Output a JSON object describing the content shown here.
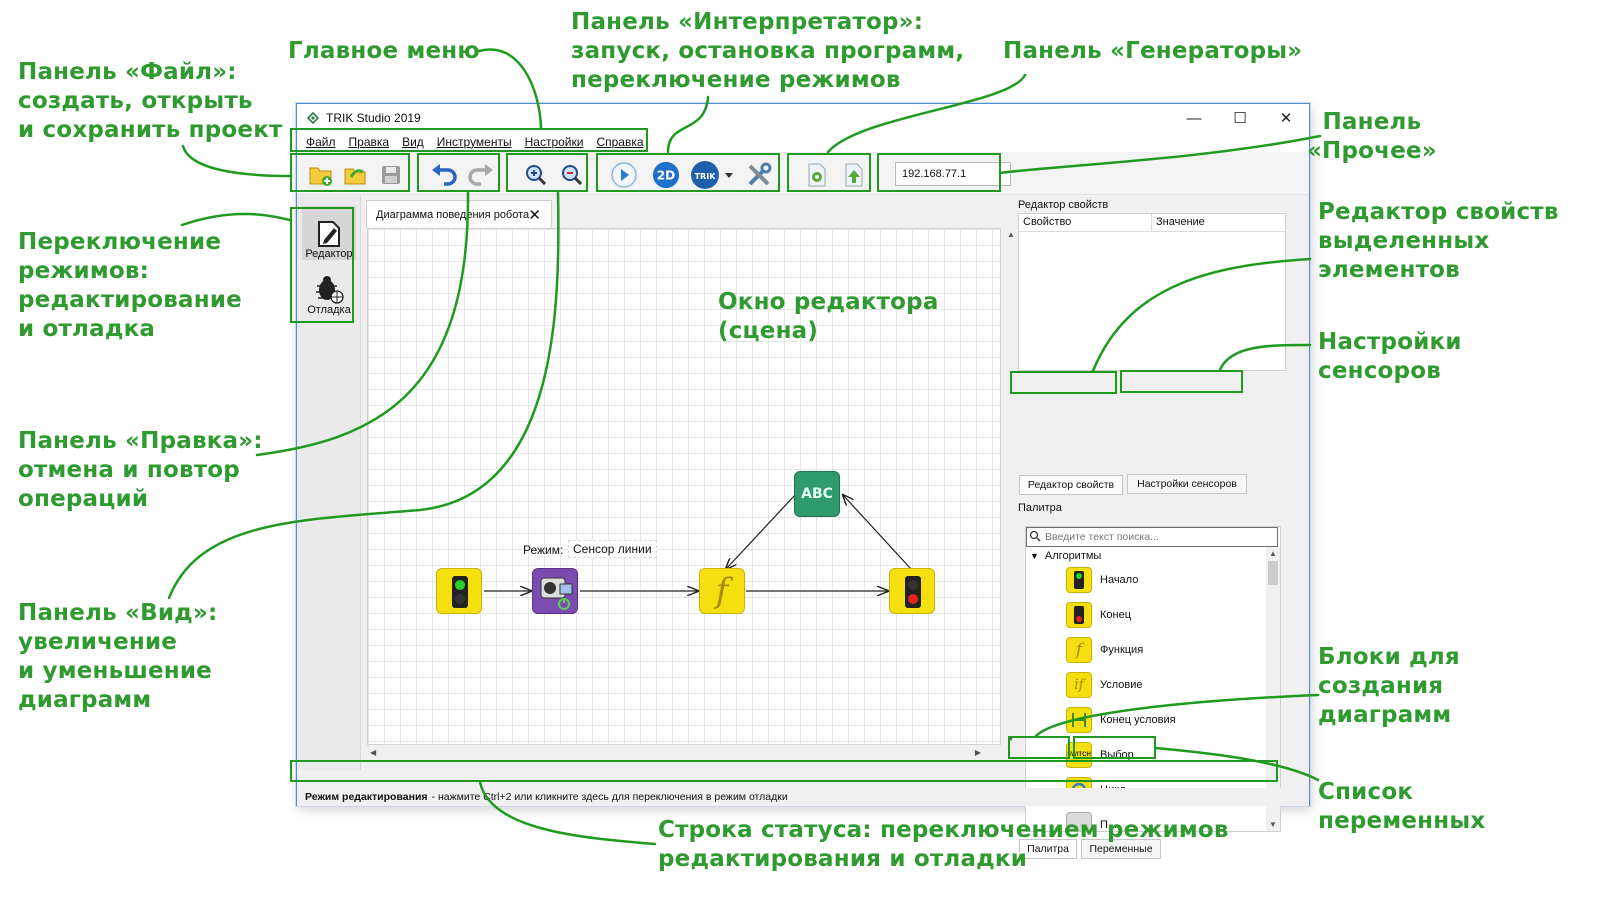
{
  "window": {
    "title": "TRIK Studio 2019",
    "controls": {
      "minimize": "—",
      "maximize": "☐",
      "close": "✕"
    }
  },
  "menu": [
    "Файл",
    "Правка",
    "Вид",
    "Инструменты",
    "Настройки",
    "Справка"
  ],
  "toolbar": {
    "ip_address": "192.168.77.1",
    "icons": [
      "new-project-icon",
      "open-project-icon",
      "save-icon",
      "undo-icon",
      "redo-icon",
      "zoom-in-icon",
      "zoom-out-icon",
      "run-icon",
      "2d-model-icon",
      "trik-robot-icon",
      "settings-tools-icon",
      "generate-code-icon",
      "upload-icon"
    ],
    "mode_2d_label": "2D",
    "trik_label": "TRIK"
  },
  "modes": {
    "editor": "Редактор",
    "debug": "Отладка"
  },
  "scene": {
    "tab_title": "Диаграмма поведения робота",
    "mode_label": "Режим:",
    "mode_value": "Сенсор линии",
    "print_block_text": "ABC",
    "function_block_text": "f"
  },
  "properties": {
    "title": "Редактор свойств",
    "col_property": "Свойство",
    "col_value": "Значение",
    "tabs": [
      "Редактор свойств",
      "Настройки сенсоров"
    ]
  },
  "palette": {
    "title": "Палитра",
    "search_placeholder": "Введите текст поиска...",
    "group": "Алгоритмы",
    "items": [
      "Начало",
      "Конец",
      "Функция",
      "Условие",
      "Конец условия",
      "Выбор",
      "Цикл",
      "П..."
    ],
    "switch_icon_text": "SWITCH",
    "tabs": [
      "Палитра",
      "Переменные"
    ]
  },
  "status": {
    "bold": "Режим редактирования",
    "text": "- нажмите Ctrl+2 или кликните здесь для переключения в режим отладки"
  },
  "annotations": {
    "file_panel": "Панель «Файл»:\nсоздать, открыть\nи сохранить проект",
    "main_menu": "Главное меню",
    "interpreter": "Панель «Интерпретатор»:\nзапуск, остановка программ,\nпереключение режимов",
    "generators": "Панель «Генераторы»",
    "other": "Панель\n«Прочее»",
    "modes": "Переключение\nрежимов:\nредактирование\nи отладка",
    "edit_panel": "Панель «Правка»:\nотмена и повтор\nопераций",
    "view_panel": "Панель «Вид»:\nувеличение\nи уменьшение\nдиаграмм",
    "editor_window": "Окно редактора\n(сцена)",
    "properties_editor": "Редактор свойств\nвыделенных\nэлементов",
    "sensor_settings": "Настройки\nсенсоров",
    "blocks": "Блоки для\nсоздания\nдиаграмм",
    "variables": "Список\nпеременных",
    "status_bar": "Строка статуса: переключением режимов\nредактирования и отладки"
  },
  "colors": {
    "annotation_green": "#2f9a2f",
    "highlight_green": "#1f9a1f",
    "block_yellow": "#f6df0e",
    "print_block_green": "#2e9a6e",
    "camera_block_purple": "#7c4bb0",
    "window_border_blue": "#4a90d9"
  }
}
